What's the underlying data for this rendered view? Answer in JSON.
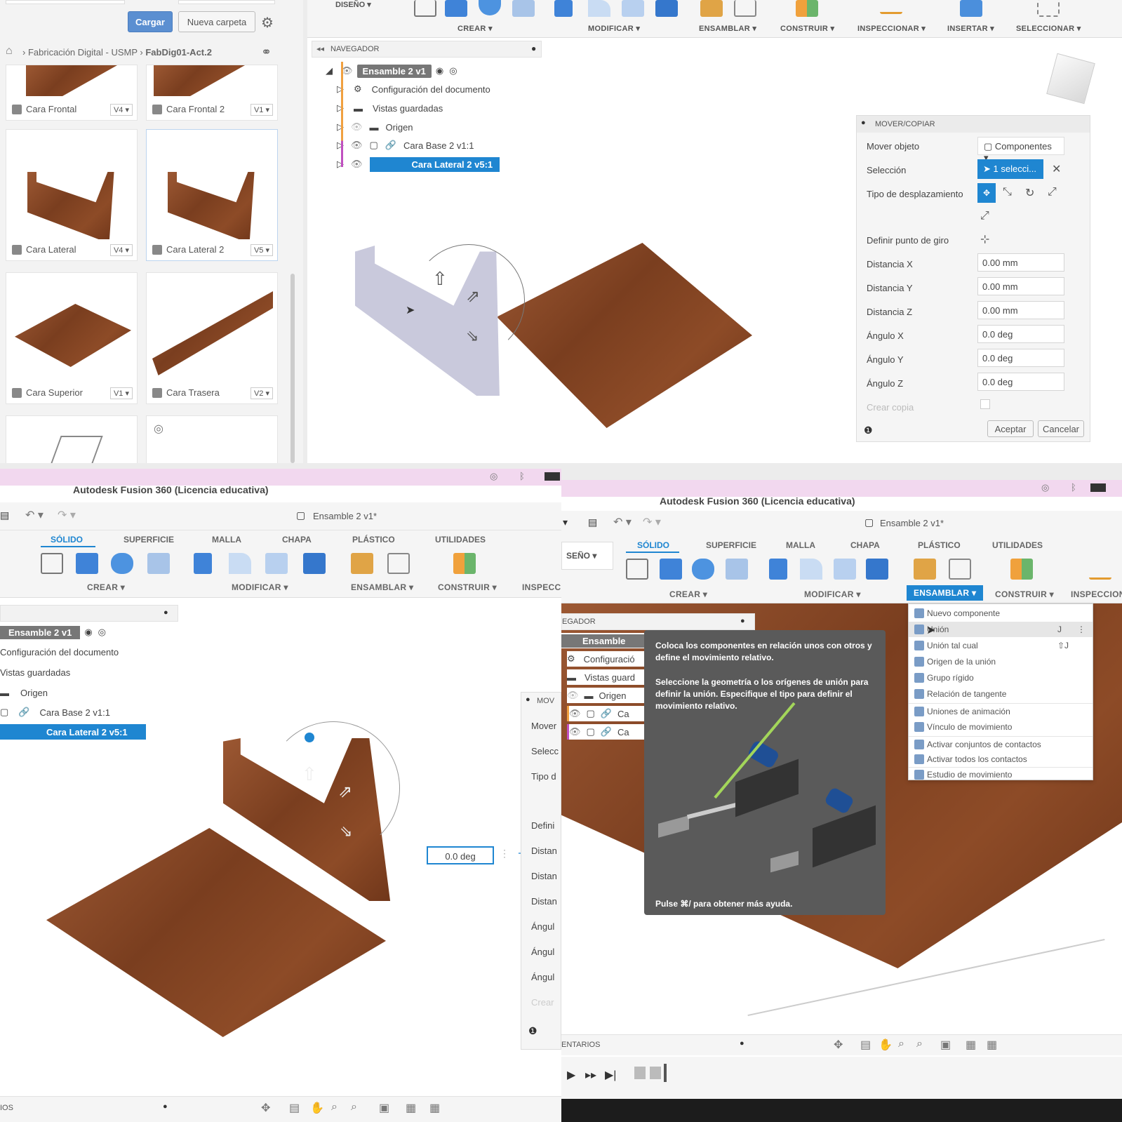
{
  "colors": {
    "accent": "#1f86d1",
    "brand_panel": "#f5f5f5",
    "wood": "#8a4a26",
    "pink_bar": "#f2d8ef"
  },
  "top_left": {
    "buttons": {
      "load": "Cargar",
      "new_folder": "Nueva carpeta"
    },
    "breadcrumb": {
      "root": "Fabricación Digital - USMP",
      "current": "FabDig01-Act.2"
    },
    "cards": [
      {
        "name": "Cara Frontal",
        "version": "V4 ▾"
      },
      {
        "name": "Cara Frontal 2",
        "version": "V1 ▾"
      },
      {
        "name": "Cara Lateral",
        "version": "V4 ▾"
      },
      {
        "name": "Cara Lateral 2",
        "version": "V5 ▾"
      },
      {
        "name": "Cara Superior",
        "version": "V1 ▾"
      },
      {
        "name": "Cara Trasera",
        "version": "V2 ▾"
      }
    ]
  },
  "top_right": {
    "design_label": "DISEÑO ▾",
    "toolbar_groups": [
      "CREAR ▾",
      "MODIFICAR ▾",
      "ENSAMBLAR ▾",
      "CONSTRUIR ▾",
      "INSPECCIONAR ▾",
      "INSERTAR ▾",
      "SELECCIONAR ▾"
    ],
    "navigator": {
      "title": "NAVEGADOR",
      "root": "Ensamble 2 v1",
      "items": [
        "Configuración del documento",
        "Vistas guardadas",
        "Origen",
        "Cara Base 2 v1:1",
        "Cara Lateral 2 v5:1"
      ]
    },
    "move_panel": {
      "title": "MOVER/COPIAR",
      "move_object_label": "Mover objeto",
      "move_object_value": "Componentes ▾",
      "selection_label": "Selección",
      "selection_value": "1 selecci...",
      "move_type_label": "Tipo de desplazamiento",
      "pivot_label": "Definir punto de giro",
      "fields": [
        {
          "label": "Distancia X",
          "value": "0.00 mm"
        },
        {
          "label": "Distancia Y",
          "value": "0.00 mm"
        },
        {
          "label": "Distancia Z",
          "value": "0.00 mm"
        },
        {
          "label": "Ángulo X",
          "value": "0.0 deg"
        },
        {
          "label": "Ángulo Y",
          "value": "0.0 deg"
        },
        {
          "label": "Ángulo Z",
          "value": "0.0 deg"
        }
      ],
      "copy_label": "Crear copia",
      "ok": "Aceptar",
      "cancel": "Cancelar"
    }
  },
  "bottom_left": {
    "app_title": "Autodesk Fusion 360 (Licencia educativa)",
    "doc_title": "Ensamble 2 v1*",
    "tabs": [
      "SÓLIDO",
      "SUPERFICIE",
      "MALLA",
      "CHAPA",
      "PLÁSTICO",
      "UTILIDADES"
    ],
    "groups": [
      "CREAR ▾",
      "MODIFICAR ▾",
      "ENSAMBLAR ▾",
      "CONSTRUIR ▾",
      "INSPECC"
    ],
    "nav_root": "Ensamble 2 v1",
    "nav_items": [
      "Configuración del documento",
      "Vistas guardadas",
      "Origen",
      "Cara Base 2 v1:1",
      "Cara Lateral 2 v5:1"
    ],
    "angle_input": "0.0 deg",
    "panel_partial": [
      "MOV",
      "Mover",
      "Selecc",
      "Tipo d",
      "Defini",
      "Distan",
      "Distan",
      "Distan",
      "Ángul",
      "Ángul",
      "Ángul",
      "Crear"
    ],
    "bottom_label": "IOS"
  },
  "bottom_right": {
    "app_title": "Autodesk Fusion 360 (Licencia educativa)",
    "doc_title": "Ensamble 2 v1*",
    "design_label": "SEÑO ▾",
    "tabs": [
      "SÓLIDO",
      "SUPERFICIE",
      "MALLA",
      "CHAPA",
      "PLÁSTICO",
      "UTILIDADES"
    ],
    "groups": [
      "CREAR ▾",
      "MODIFICAR ▾",
      "ENSAMBLAR ▾",
      "CONSTRUIR ▾",
      "INSPECCION"
    ],
    "nav_title": "EGADOR",
    "nav_root": "Ensamble",
    "nav_items": [
      "Configuració",
      "Vistas guard",
      "Origen",
      "Ca",
      "Ca"
    ],
    "menu": [
      "Nuevo componente",
      "Unión",
      "Unión tal cual",
      "Origen de la unión",
      "Grupo rígido",
      "Relación de tangente",
      "Uniones de animación",
      "Vínculo de movimiento",
      "Activar conjuntos de contactos",
      "Activar todos los contactos",
      "Estudio de movimiento"
    ],
    "menu_shortcuts": {
      "union": "J",
      "union_tal_cual": "⇧J"
    },
    "tooltip": {
      "p1": "Coloca los componentes en relación unos con otros y define el movimiento relativo.",
      "p2": "Seleccione la geometría o los orígenes de unión para definir la unión. Especifique el tipo para definir el movimiento relativo.",
      "help": "Pulse ⌘/ para obtener más ayuda."
    },
    "comments_label": "ENTARIOS"
  }
}
